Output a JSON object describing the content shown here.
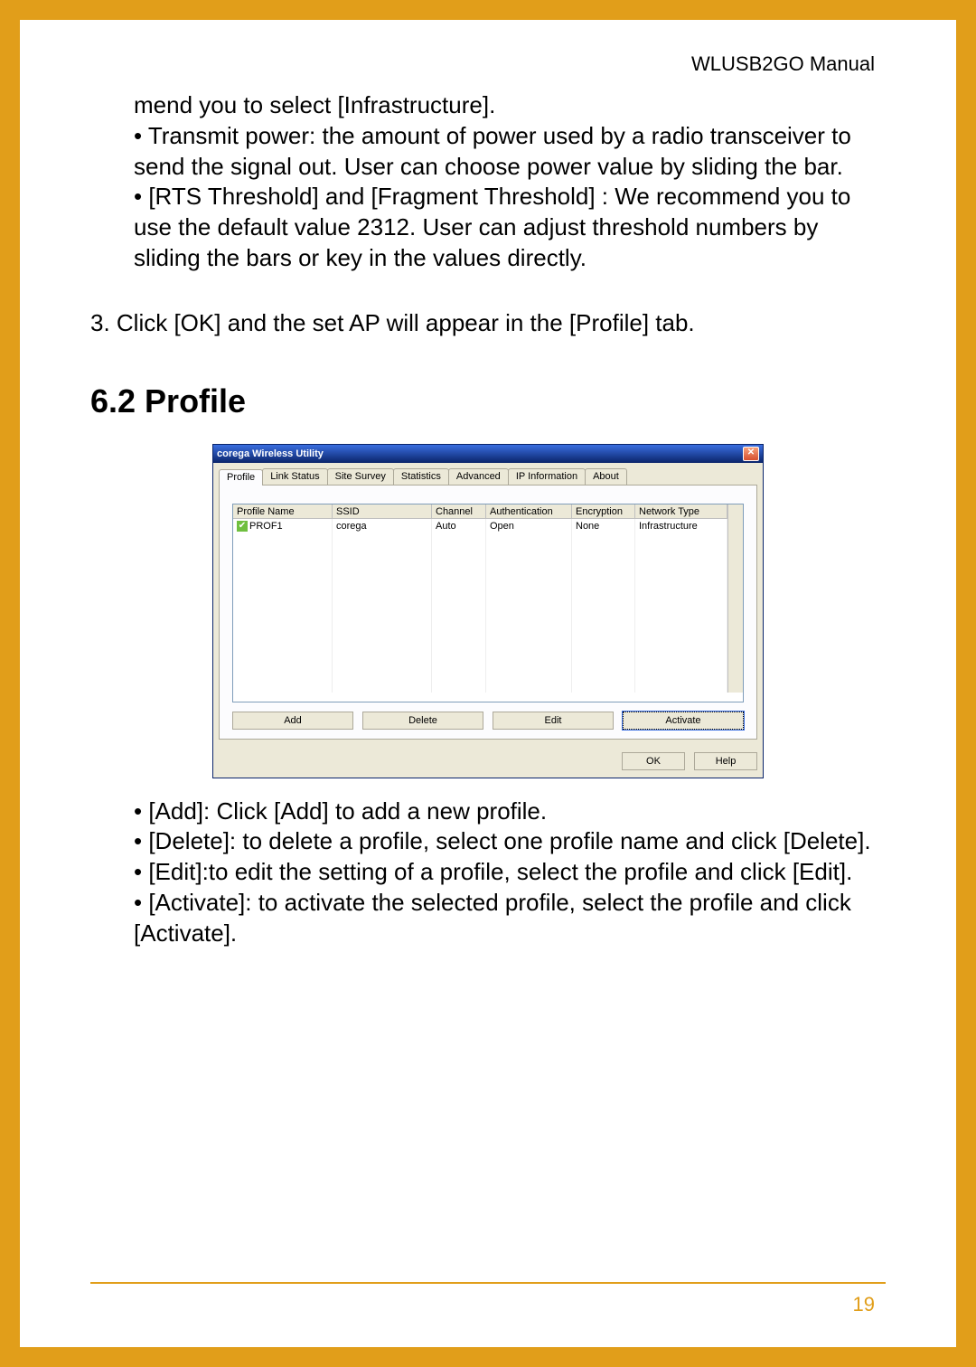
{
  "header": {
    "title": "WLUSB2GO  Manual"
  },
  "body": {
    "frag1": "mend you to select [Infrastructure].",
    "bullet_transmit": "• Transmit power:  the amount of power used by a radio transceiver to send the signal out. User can choose power value by sliding the bar.",
    "bullet_rts": "• [RTS Threshold] and [Fragment Threshold] : We recommend you to use the default value 2312. User can adjust threshold numbers by sliding the bars or key in the values directly.",
    "step3": "3. Click [OK] and the set AP will appear in the [Profile] tab.",
    "heading": "6.2 Profile",
    "bullet_add": "• [Add]:  Click [Add] to add a new profile.",
    "bullet_delete": "• [Delete]: to delete a profile, select one profile name and click [Delete].",
    "bullet_edit": "• [Edit]:to edit the setting of a profile, select the profile and click [Edit].",
    "bullet_activate": "• [Activate]: to activate the selected profile, select the profile and click [Activate]."
  },
  "dialog": {
    "title": "corega Wireless Utility",
    "tabs": [
      "Profile",
      "Link Status",
      "Site Survey",
      "Statistics",
      "Advanced",
      "IP Information",
      "About"
    ],
    "columns": [
      "Profile Name",
      "SSID",
      "Channel",
      "Authentication",
      "Encryption",
      "Network Type"
    ],
    "rows": [
      {
        "name": "PROF1",
        "ssid": "corega",
        "channel": "Auto",
        "auth": "Open",
        "enc": "None",
        "net": "Infrastructure"
      }
    ],
    "buttons": {
      "add": "Add",
      "delete": "Delete",
      "edit": "Edit",
      "activate": "Activate",
      "ok": "OK",
      "help": "Help"
    }
  },
  "page_number": "19"
}
